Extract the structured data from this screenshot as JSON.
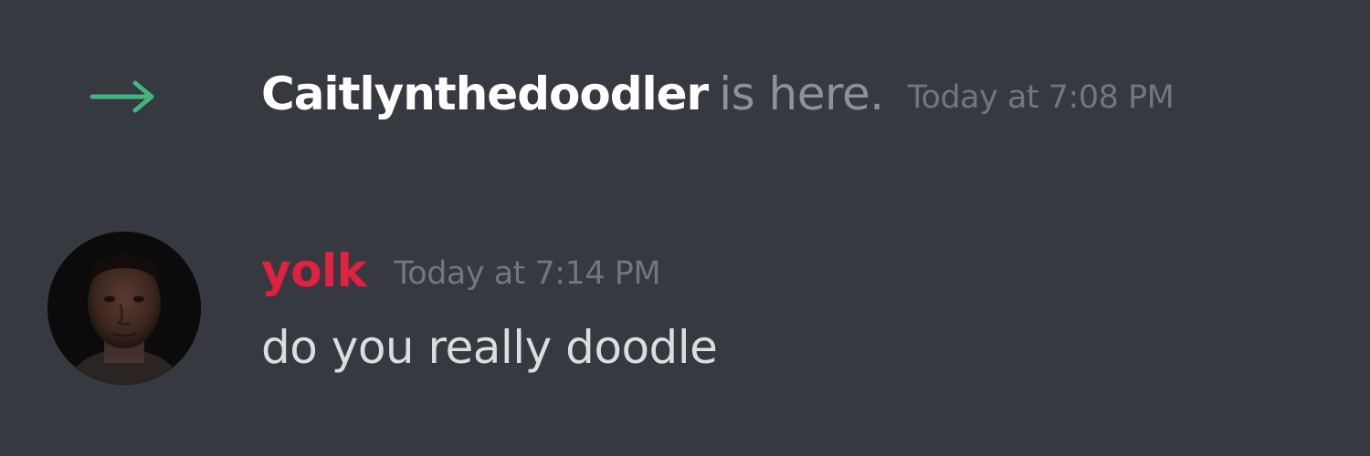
{
  "colors": {
    "background": "#36393f",
    "join_arrow": "#43b581",
    "join_username": "#ffffff",
    "join_text": "#8e9297",
    "timestamp": "#72767d",
    "message_username": "#e0213f",
    "message_text": "#dcddde"
  },
  "system_message": {
    "icon": "join-arrow-icon",
    "username": "Caitlynthedoodler",
    "text": "is here.",
    "timestamp": "Today at 7:08 PM"
  },
  "message": {
    "avatar": "avatar",
    "username": "yolk",
    "timestamp": "Today at 7:14 PM",
    "content": "do you really doodle"
  }
}
